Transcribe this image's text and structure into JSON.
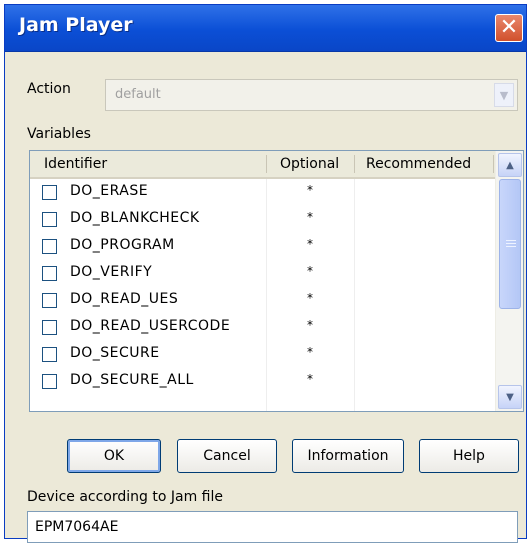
{
  "window": {
    "title": "Jam Player",
    "close_symbol": "✕"
  },
  "action": {
    "label": "Action",
    "value": "default",
    "arrow": "▼"
  },
  "variables": {
    "label": "Variables",
    "columns": [
      "Identifier",
      "Optional",
      "Recommended"
    ],
    "rows": [
      {
        "identifier": "DO_ERASE",
        "optional": "*",
        "recommended": ""
      },
      {
        "identifier": "DO_BLANKCHECK",
        "optional": "*",
        "recommended": ""
      },
      {
        "identifier": "DO_PROGRAM",
        "optional": "*",
        "recommended": ""
      },
      {
        "identifier": "DO_VERIFY",
        "optional": "*",
        "recommended": ""
      },
      {
        "identifier": "DO_READ_UES",
        "optional": "*",
        "recommended": ""
      },
      {
        "identifier": "DO_READ_USERCODE",
        "optional": "*",
        "recommended": ""
      },
      {
        "identifier": "DO_SECURE",
        "optional": "*",
        "recommended": ""
      },
      {
        "identifier": "DO_SECURE_ALL",
        "optional": "*",
        "recommended": ""
      }
    ],
    "scroll_up": "▲",
    "scroll_down": "▼"
  },
  "buttons": {
    "ok": "OK",
    "cancel": "Cancel",
    "information": "Information",
    "help": "Help"
  },
  "device": {
    "label": "Device according to Jam file",
    "value": "EPM7064AE"
  },
  "colors": {
    "titlebar": "#0b4fd6",
    "close": "#d1502c",
    "dialog": "#ece9d8"
  }
}
